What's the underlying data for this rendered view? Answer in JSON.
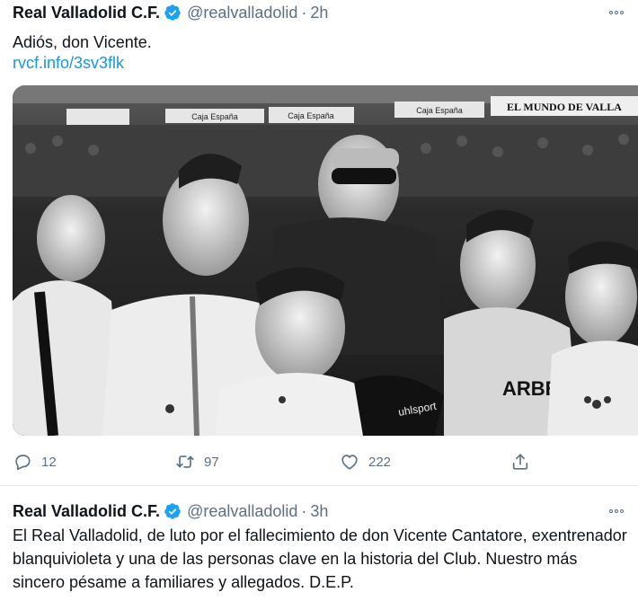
{
  "tweets": [
    {
      "author_name": "Real Valladolid C.F.",
      "handle": "@realvalladolid",
      "separator": "·",
      "time": "2h",
      "text": "Adiós, don Vicente.",
      "link": "rvcf.info/3sv3flk",
      "media": {
        "banners": [
          "Caja España",
          "Caja España",
          "Caja España",
          "EL MUNDO DE VALLA"
        ],
        "jersey_text": "ARBELLA",
        "glove_text": "uhlsport"
      },
      "actions": {
        "replies": "12",
        "retweets": "97",
        "likes": "222"
      }
    },
    {
      "author_name": "Real Valladolid C.F.",
      "handle": "@realvalladolid",
      "separator": "·",
      "time": "3h",
      "text": "El Real Valladolid, de luto por el fallecimiento de don Vicente Cantatore, exentrenador blanquivioleta y una de las personas clave en la historia del Club. Nuestro más sincero pésame a familiares y allegados. D.E.P."
    }
  ],
  "colors": {
    "text": "#0f1419",
    "secondary": "#5b7083",
    "link": "#1b95e0",
    "verified": "#1da1f2",
    "divider": "#e3e8ec"
  },
  "icons": [
    "verified-badge-icon",
    "more-icon",
    "reply-icon",
    "retweet-icon",
    "like-icon",
    "share-icon"
  ]
}
